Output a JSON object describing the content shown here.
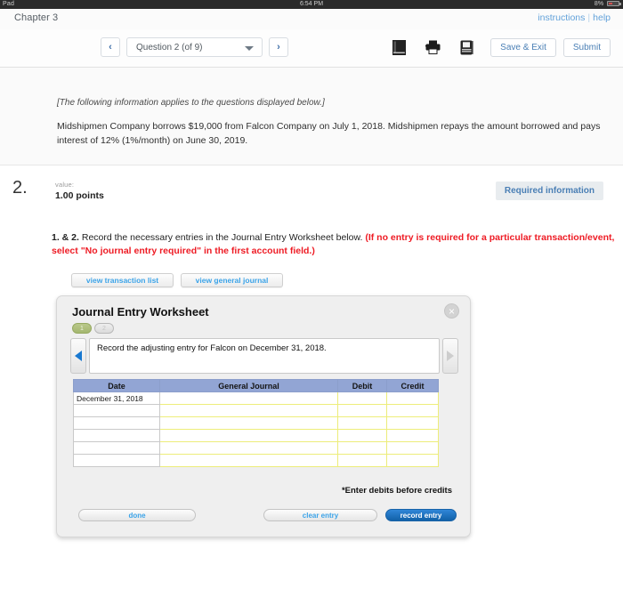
{
  "status_bar": {
    "carrier": "Pad",
    "time": "6:54 PM",
    "battery": "8%"
  },
  "header": {
    "chapter": "Chapter 3",
    "instructions_link": "instructions",
    "separator": "|",
    "help_link": "help"
  },
  "toolbar": {
    "prev_arrow": "‹",
    "next_arrow": "›",
    "question_selector": "Question 2 (of 9)",
    "icons": [
      "ebook-icon",
      "print-icon",
      "references-icon"
    ],
    "save_exit_label": "Save & Exit",
    "submit_label": "Submit"
  },
  "info": {
    "applies_note": "[The following information applies to the questions displayed below.]",
    "body": "Midshipmen Company borrows $19,000 from Falcon Company on July 1, 2018. Midshipmen repays the amount borrowed and pays interest of 12% (1%/month) on June 30, 2019."
  },
  "question": {
    "number": "2.",
    "value_label": "value:",
    "points": "1.00 points",
    "required_badge": "Required information",
    "prompt_prefix": "1. & 2.",
    "prompt_main": " Record the necessary entries in the Journal Entry Worksheet below. ",
    "prompt_red": "(If no entry is required for a particular transaction/event, select \"No journal entry required\" in the first account field.)"
  },
  "tabs": [
    {
      "label": "view transaction list"
    },
    {
      "label": "view general journal"
    }
  ],
  "worksheet": {
    "title": "Journal Entry Worksheet",
    "close_icon": "×",
    "pills": [
      {
        "label": "1",
        "state": "active"
      },
      {
        "label": "2",
        "state": "idle"
      }
    ],
    "record_text": "Record the adjusting entry for Falcon on December 31, 2018.",
    "table": {
      "columns": [
        "Date",
        "General Journal",
        "Debit",
        "Credit"
      ],
      "rows": [
        {
          "date": "December 31, 2018",
          "general_journal": "",
          "debit": "",
          "credit": ""
        },
        {
          "date": "",
          "general_journal": "",
          "debit": "",
          "credit": ""
        },
        {
          "date": "",
          "general_journal": "",
          "debit": "",
          "credit": ""
        },
        {
          "date": "",
          "general_journal": "",
          "debit": "",
          "credit": ""
        },
        {
          "date": "",
          "general_journal": "",
          "debit": "",
          "credit": ""
        },
        {
          "date": "",
          "general_journal": "",
          "debit": "",
          "credit": ""
        }
      ]
    },
    "debit_note": "*Enter debits before credits",
    "buttons": {
      "done": "done",
      "clear_entry": "clear entry",
      "record_entry": "record entry"
    }
  },
  "colors": {
    "link_blue": "#4a7fb5",
    "tab_blue": "#3ba3e8",
    "alert_red": "#ee1b24",
    "table_header_blue": "#92a5d4",
    "input_yellow": "#eded7a",
    "record_btn_blue": "#1261a8",
    "pill_green": "#a4b76f"
  }
}
